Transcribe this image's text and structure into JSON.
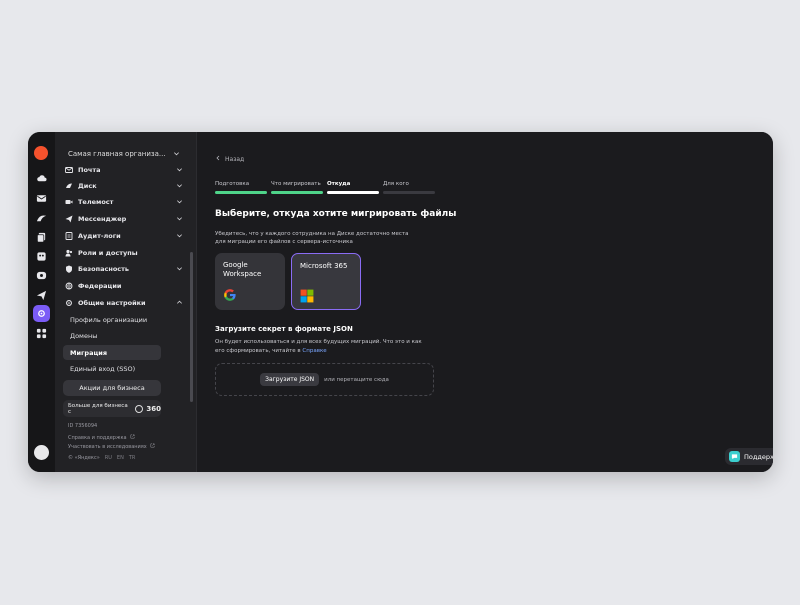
{
  "sidebar": {
    "org_name": "Самая главная организа...",
    "menu": [
      {
        "label": "Почта",
        "icon": "mail-icon",
        "chevron": true
      },
      {
        "label": "Диск",
        "icon": "disk-icon",
        "chevron": true
      },
      {
        "label": "Телемост",
        "icon": "video-icon",
        "chevron": true
      },
      {
        "label": "Мессенджер",
        "icon": "messenger-icon",
        "chevron": true
      },
      {
        "label": "Аудит-логи",
        "icon": "audit-icon",
        "chevron": true
      },
      {
        "label": "Роли и доступы",
        "icon": "roles-icon",
        "chevron": false
      },
      {
        "label": "Безопасность",
        "icon": "shield-icon",
        "chevron": true
      },
      {
        "label": "Федерации",
        "icon": "federation-icon",
        "chevron": false
      },
      {
        "label": "Общие настройки",
        "icon": "gear-icon",
        "chevron": true
      }
    ],
    "sub_items": [
      {
        "label": "Профиль организации"
      },
      {
        "label": "Домены"
      },
      {
        "label": "Миграция"
      },
      {
        "label": "Единый вход (SSO)"
      }
    ],
    "promo_button": "Акции для бизнеса",
    "business_promo": {
      "text": "Больше для бизнеса с",
      "number": "360"
    },
    "footer": {
      "id": "ID 7356094",
      "help": "Справка и поддержка",
      "research": "Участвовать в исследованиях",
      "copyright": "© «Яндекс»",
      "langs": [
        "RU",
        "EN",
        "TR"
      ]
    }
  },
  "main": {
    "back": "Назад",
    "steps": [
      {
        "label": "Подготовка",
        "state": "done"
      },
      {
        "label": "Что мигрировать",
        "state": "done"
      },
      {
        "label": "Откуда",
        "state": "current"
      },
      {
        "label": "Для кого",
        "state": "pending"
      }
    ],
    "heading": "Выберите, откуда хотите мигрировать файлы",
    "description": "Убедитесь, что у каждого сотрудника на Диске достаточно места для миграции его файлов с сервера-источника",
    "sources": [
      {
        "name": "Google Workspace",
        "icon": "google-icon",
        "selected": false
      },
      {
        "name": "Microsoft 365",
        "icon": "microsoft-icon",
        "selected": true
      }
    ],
    "json_section": {
      "title": "Загрузите секрет в формате JSON",
      "description": "Он будет использоваться и для всех будущих миграций. Что это и как его сформировать, читайте в",
      "link": "Справке",
      "upload_button": "Загрузите JSON",
      "drop_hint": "или перетащите сюда"
    },
    "support_button": "Поддержка"
  },
  "colors": {
    "accent": "#7b5cf6",
    "done": "#4fd48a",
    "link": "#7aa6ff",
    "brand": "#f5522d"
  }
}
